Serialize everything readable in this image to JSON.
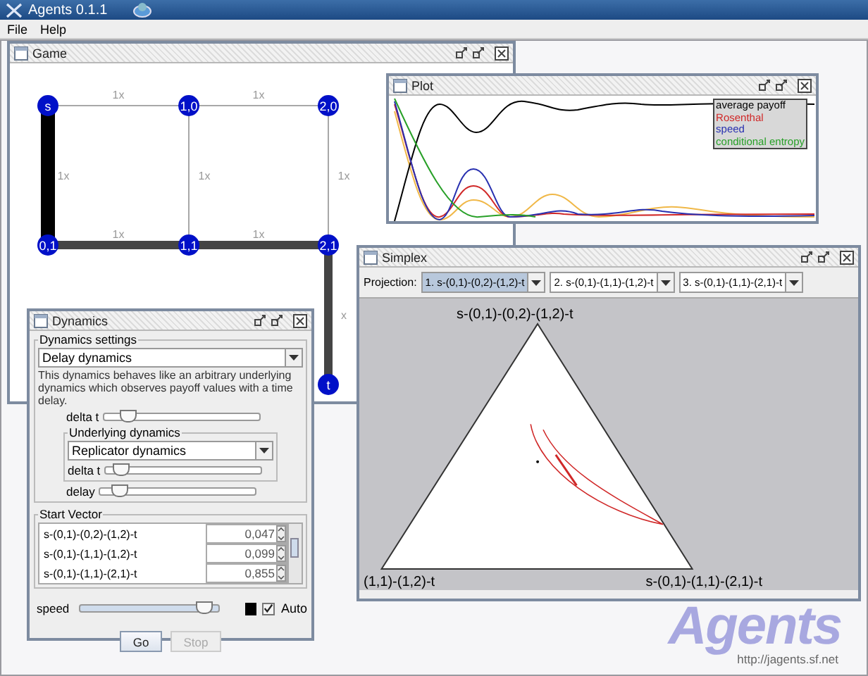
{
  "app": {
    "title": "Agents 0.1.1"
  },
  "menu": [
    {
      "label": "File"
    },
    {
      "label": "Help"
    }
  ],
  "game": {
    "title": "Game",
    "nodes": [
      {
        "label": "s"
      },
      {
        "label": "1,0"
      },
      {
        "label": "2,0"
      },
      {
        "label": "0,1"
      },
      {
        "label": "1,1"
      },
      {
        "label": "2,1"
      },
      {
        "label": "t"
      }
    ],
    "edges": [
      {
        "label": "1x",
        "kind": "thin"
      },
      {
        "label": "1x",
        "kind": "thin"
      },
      {
        "label": "1x",
        "kind": "heavy"
      },
      {
        "label": "1x",
        "kind": "thin"
      },
      {
        "label": "1x",
        "kind": "thin"
      },
      {
        "label": "1x",
        "kind": "thick"
      },
      {
        "label": "1x",
        "kind": "thick"
      },
      {
        "label": "x",
        "kind": "thick"
      }
    ]
  },
  "plot": {
    "title": "Plot",
    "legend": [
      {
        "label": "average payoff",
        "color": "#000000"
      },
      {
        "label": "Rosenthal",
        "color": "#d02828"
      },
      {
        "label": "speed",
        "color": "#2830b0"
      },
      {
        "label": "conditional entropy",
        "color": "#28a028"
      }
    ]
  },
  "simplex": {
    "title": "Simplex",
    "projection_label": "Projection:",
    "projections": [
      {
        "label": "1. s-(0,1)-(0,2)-(1,2)-t",
        "selected": true
      },
      {
        "label": "2. s-(0,1)-(1,1)-(1,2)-t",
        "selected": false
      },
      {
        "label": "3. s-(0,1)-(1,1)-(2,1)-t",
        "selected": false
      }
    ],
    "vertices": [
      "s-(0,1)-(0,2)-(1,2)-t",
      "(1,1)-(1,2)-t",
      "s-(0,1)-(1,1)-(2,1)-t"
    ]
  },
  "dynamics": {
    "title": "Dynamics",
    "settings_title": "Dynamics settings",
    "dynamics_choice": "Delay dynamics",
    "description": "This dynamics behaves like an arbitrary underlying dynamics which observes payoff values with a time delay.",
    "delta_t": {
      "label": "delta t",
      "level": 0.15
    },
    "underlying": {
      "title": "Underlying dynamics",
      "choice": "Replicator dynamics",
      "delta_t": {
        "label": "delta t",
        "level": 0.1
      }
    },
    "delay": {
      "label": "delay",
      "level": 0.12
    },
    "start_vector": {
      "title": "Start Vector",
      "rows": [
        {
          "label": "s-(0,1)-(0,2)-(1,2)-t",
          "value": "0,047"
        },
        {
          "label": "s-(0,1)-(1,1)-(1,2)-t",
          "value": "0,099"
        },
        {
          "label": "s-(0,1)-(1,1)-(2,1)-t",
          "value": "0,855"
        }
      ]
    },
    "speed": {
      "label": "speed",
      "level": 0.9
    },
    "auto": {
      "label": "Auto",
      "checked": true
    },
    "buttons": [
      {
        "label": "Go",
        "disabled": false
      },
      {
        "label": "Stop",
        "disabled": true
      }
    ]
  },
  "logo": {
    "name": "Agents",
    "url": "http://jagents.sf.net"
  }
}
